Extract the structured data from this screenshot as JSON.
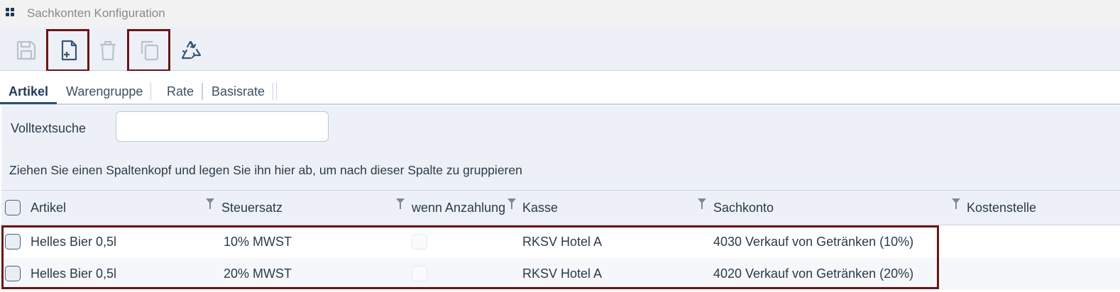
{
  "window": {
    "title": "Sachkonten Konfiguration"
  },
  "toolbar": {
    "buttons": [
      {
        "name": "save",
        "icon": "save-icon",
        "enabled": false,
        "highlighted": false
      },
      {
        "name": "new",
        "icon": "file-plus-icon",
        "enabled": true,
        "highlighted": true
      },
      {
        "name": "delete",
        "icon": "trash-icon",
        "enabled": false,
        "highlighted": false
      },
      {
        "name": "copy",
        "icon": "copy-icon",
        "enabled": false,
        "highlighted": true
      },
      {
        "name": "recycle",
        "icon": "recycle-icon",
        "enabled": true,
        "highlighted": false
      }
    ]
  },
  "tabs": [
    {
      "label": "Artikel",
      "active": true
    },
    {
      "label": "Warengruppe",
      "active": false
    },
    {
      "label": "Rate",
      "active": false
    },
    {
      "label": "Basisrate",
      "active": false
    }
  ],
  "search": {
    "label": "Volltextsuche",
    "value": ""
  },
  "grouping_hint": "Ziehen Sie einen Spaltenkopf und legen Sie ihn hier ab, um nach dieser Spalte zu gruppieren",
  "grid": {
    "columns": [
      "Artikel",
      "Steuersatz",
      "wenn Anzahlung",
      "Kasse",
      "Sachkonto",
      "Kostenstelle"
    ],
    "rows": [
      {
        "artikel": "Helles Bier 0,5l",
        "steuersatz": "10% MWST",
        "anzahlung": false,
        "kasse": "RKSV Hotel A",
        "sachkonto": "4030 Verkauf von Getränken (10%)",
        "kostenstelle": ""
      },
      {
        "artikel": "Helles Bier 0,5l",
        "steuersatz": "20% MWST",
        "anzahlung": false,
        "kasse": "RKSV Hotel A",
        "sachkonto": "4020 Verkauf von Getränken (20%)",
        "kostenstelle": ""
      }
    ]
  },
  "colors": {
    "accent": "#2f4f73",
    "highlight_border": "#6b1515",
    "panel": "#edf1f7"
  }
}
